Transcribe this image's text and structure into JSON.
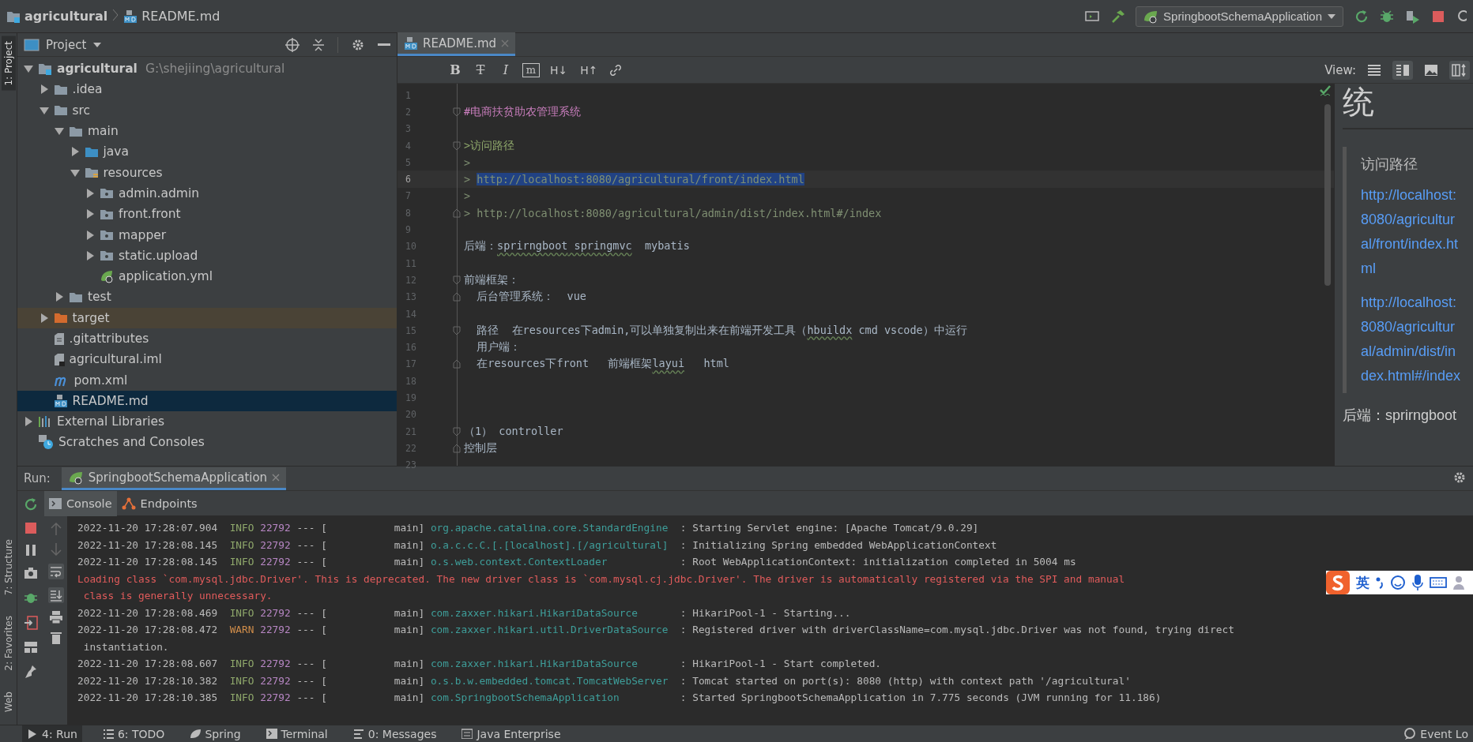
{
  "navbar": {
    "breadcrumbs": [
      {
        "label": "agricultural"
      },
      {
        "label": "README.md"
      }
    ],
    "run_config": "SpringbootSchemaApplication"
  },
  "side_strip": {
    "top": [
      {
        "label": "1: Project",
        "selected": true
      }
    ],
    "bottom": [
      {
        "label": "7: Structure",
        "selected": false
      },
      {
        "label": "2: Favorites",
        "selected": false
      },
      {
        "label": "Web",
        "selected": false
      }
    ]
  },
  "project": {
    "title": "Project",
    "tree": [
      {
        "label": "agricultural",
        "note": "G:\\shejiing\\agricultural",
        "kind": "module",
        "expanded": true,
        "selected": false,
        "children": [
          {
            "label": ".idea",
            "kind": "folder",
            "expanded": false,
            "selected": false
          },
          {
            "label": "src",
            "kind": "folder",
            "expanded": true,
            "selected": false,
            "children": [
              {
                "label": "main",
                "kind": "folder",
                "expanded": true,
                "selected": false,
                "children": [
                  {
                    "label": "java",
                    "kind": "source",
                    "expanded": false,
                    "selected": false
                  },
                  {
                    "label": "resources",
                    "kind": "resources",
                    "expanded": true,
                    "selected": false,
                    "children": [
                      {
                        "label": "admin.admin",
                        "kind": "package",
                        "expanded": false,
                        "selected": false
                      },
                      {
                        "label": "front.front",
                        "kind": "package",
                        "expanded": false,
                        "selected": false
                      },
                      {
                        "label": "mapper",
                        "kind": "package",
                        "expanded": false,
                        "selected": false
                      },
                      {
                        "label": "static.upload",
                        "kind": "package",
                        "expanded": false,
                        "selected": false
                      },
                      {
                        "label": "application.yml",
                        "kind": "spring",
                        "selected": false
                      }
                    ]
                  }
                ]
              },
              {
                "label": "test",
                "kind": "folder",
                "expanded": false,
                "selected": false
              }
            ]
          },
          {
            "label": "target",
            "kind": "excluded",
            "expanded": false,
            "selected": false
          },
          {
            "label": ".gitattributes",
            "kind": "text",
            "selected": false
          },
          {
            "label": "agricultural.iml",
            "kind": "iml",
            "selected": false
          },
          {
            "label": "pom.xml",
            "kind": "maven",
            "selected": false
          },
          {
            "label": "README.md",
            "kind": "markdown",
            "selected": true
          }
        ]
      },
      {
        "label": "External Libraries",
        "kind": "libraries",
        "expanded": false,
        "selected": false
      },
      {
        "label": "Scratches and Consoles",
        "kind": "scratches",
        "selected": false
      }
    ]
  },
  "editor": {
    "tabs": [
      {
        "label": "README.md",
        "selected": true
      }
    ],
    "toolbar": [
      {
        "kind": "bold",
        "label": "B"
      },
      {
        "kind": "strike",
        "label": "T"
      },
      {
        "kind": "italic",
        "label": "I"
      },
      {
        "kind": "code",
        "label": "m"
      },
      {
        "kind": "heading",
        "label": "H↓"
      },
      {
        "kind": "heading",
        "label": "H↑"
      },
      {
        "kind": "link"
      }
    ],
    "view_label": "View:",
    "lines": [
      {
        "number": "1",
        "kind": "line"
      },
      {
        "number": "2",
        "kind": "fold-start",
        "segments": [
          {
            "text": "#电商扶贫助农管理系统",
            "kind": "heading"
          }
        ]
      },
      {
        "number": "3",
        "kind": "line"
      },
      {
        "number": "4",
        "kind": "fold-start",
        "segments": [
          {
            "text": ">访问路径",
            "kind": "quote"
          }
        ]
      },
      {
        "number": "5",
        "kind": "line",
        "segments": [
          {
            "text": ">",
            "kind": "url"
          }
        ]
      },
      {
        "number": "6",
        "kind": "line",
        "current": true,
        "segments": [
          {
            "text": "> ",
            "kind": "url"
          },
          {
            "text": "http://localhost:8080/agricultural/front/index.html",
            "kind": "url",
            "selected": true
          }
        ]
      },
      {
        "number": "7",
        "kind": "line",
        "segments": [
          {
            "text": ">",
            "kind": "url"
          }
        ]
      },
      {
        "number": "8",
        "kind": "fold-end",
        "segments": [
          {
            "text": "> http://localhost:8080/agricultural/admin/dist/index.html#/index",
            "kind": "url"
          }
        ]
      },
      {
        "number": "9",
        "kind": "line"
      },
      {
        "number": "10",
        "kind": "line",
        "segments": [
          {
            "text": "后端：",
            "kind": "plain"
          },
          {
            "text": "sprirngboot",
            "kind": "typo"
          },
          {
            "text": " springmvc",
            "kind": "typo"
          },
          {
            "text": "  mybatis",
            "kind": "plain"
          }
        ]
      },
      {
        "number": "11",
        "kind": "line"
      },
      {
        "number": "12",
        "kind": "fold-start",
        "segments": [
          {
            "text": "前端框架：",
            "kind": "plain"
          }
        ]
      },
      {
        "number": "13",
        "kind": "fold-end",
        "segments": [
          {
            "text": "  后台管理系统：  vue",
            "kind": "plain"
          }
        ]
      },
      {
        "number": "14",
        "kind": "line"
      },
      {
        "number": "15",
        "kind": "fold-start",
        "segments": [
          {
            "text": "  路径  在resources下admin,可以单独复制出来在前端开发工具（",
            "kind": "plain"
          },
          {
            "text": "hbuildx",
            "kind": "typo"
          },
          {
            "text": " cmd vscode）中运行",
            "kind": "plain"
          }
        ]
      },
      {
        "number": "16",
        "kind": "line",
        "segments": [
          {
            "text": "  用户端：",
            "kind": "plain"
          }
        ]
      },
      {
        "number": "17",
        "kind": "fold-end",
        "segments": [
          {
            "text": "  在resources下front   前端框架",
            "kind": "plain"
          },
          {
            "text": "layui",
            "kind": "typo"
          },
          {
            "text": "   html",
            "kind": "plain"
          }
        ]
      },
      {
        "number": "18",
        "kind": "line"
      },
      {
        "number": "19",
        "kind": "line"
      },
      {
        "number": "20",
        "kind": "line"
      },
      {
        "number": "21",
        "kind": "fold-start",
        "segments": [
          {
            "text": "（1） controller",
            "kind": "plain"
          }
        ]
      },
      {
        "number": "22",
        "kind": "fold-end",
        "segments": [
          {
            "text": "控制层",
            "kind": "plain"
          }
        ]
      },
      {
        "number": "23",
        "kind": "line"
      }
    ]
  },
  "preview": {
    "heading": "统",
    "quote": "访问路径",
    "links": [
      "http://localhost:8080/agricultural/front/index.html",
      "http://localhost:8080/agricultural/admin/dist/index.html#/index"
    ],
    "paragraph": "后端：sprirngboot"
  },
  "run": {
    "label": "Run:",
    "tabs": [
      {
        "label": "SpringbootSchemaApplication",
        "selected": true
      }
    ],
    "subtabs": [
      {
        "label": "Console",
        "kind": "console",
        "selected": true
      },
      {
        "label": "Endpoints",
        "kind": "endpoints",
        "selected": false
      }
    ],
    "lines": [
      {
        "kind": "info",
        "time": "2022-11-20 17:28:07.904",
        "level": "INFO",
        "pid": "22792",
        "sep": "--- [",
        "thread": "main]",
        "logger": "org.apache.catalina.core.StandardEngine",
        "message": ": Starting Servlet engine: [Apache Tomcat/9.0.29]"
      },
      {
        "kind": "info",
        "time": "2022-11-20 17:28:08.145",
        "level": "INFO",
        "pid": "22792",
        "sep": "--- [",
        "thread": "main]",
        "logger": "o.a.c.c.C.[.[localhost].[/agricultural]",
        "message": ": Initializing Spring embedded WebApplicationContext"
      },
      {
        "kind": "info",
        "time": "2022-11-20 17:28:08.145",
        "level": "INFO",
        "pid": "22792",
        "sep": "--- [",
        "thread": "main]",
        "logger": "o.s.web.context.ContextLoader",
        "message": ": Root WebApplicationContext: initialization completed in 5004 ms"
      },
      {
        "kind": "error",
        "text": "Loading class `com.mysql.jdbc.Driver'. This is deprecated. The new driver class is `com.mysql.cj.jdbc.Driver'. The driver is automatically registered via the SPI and manual"
      },
      {
        "kind": "error",
        "text": " class is generally unnecessary."
      },
      {
        "kind": "info",
        "time": "2022-11-20 17:28:08.469",
        "level": "INFO",
        "pid": "22792",
        "sep": "--- [",
        "thread": "main]",
        "logger": "com.zaxxer.hikari.HikariDataSource",
        "message": ": HikariPool-1 - Starting..."
      },
      {
        "kind": "warn",
        "time": "2022-11-20 17:28:08.472",
        "level": "WARN",
        "pid": "22792",
        "sep": "--- [",
        "thread": "main]",
        "logger": "com.zaxxer.hikari.util.DriverDataSource",
        "message": ": Registered driver with driverClassName=com.mysql.jdbc.Driver was not found, trying direct"
      },
      {
        "kind": "plain",
        "text": " instantiation."
      },
      {
        "kind": "info",
        "time": "2022-11-20 17:28:08.607",
        "level": "INFO",
        "pid": "22792",
        "sep": "--- [",
        "thread": "main]",
        "logger": "com.zaxxer.hikari.HikariDataSource",
        "message": ": HikariPool-1 - Start completed."
      },
      {
        "kind": "info",
        "time": "2022-11-20 17:28:10.382",
        "level": "INFO",
        "pid": "22792",
        "sep": "--- [",
        "thread": "main]",
        "logger": "o.s.b.w.embedded.tomcat.TomcatWebServer",
        "message": ": Tomcat started on port(s): 8080 (http) with context path '/agricultural'"
      },
      {
        "kind": "info",
        "time": "2022-11-20 17:28:10.385",
        "level": "INFO",
        "pid": "22792",
        "sep": "--- [",
        "thread": "main]",
        "logger": "com.SpringbootSchemaApplication",
        "message": ": Started SpringbootSchemaApplication in 7.775 seconds (JVM running for 11.186)"
      }
    ]
  },
  "ime_bar": {
    "mode": "英"
  },
  "status_bar": {
    "tabs": [
      {
        "label": "4: Run",
        "kind": "run",
        "selected": true
      },
      {
        "label": "6: TODO",
        "kind": "list",
        "selected": false
      },
      {
        "label": "Spring",
        "kind": "leaf",
        "selected": false
      },
      {
        "label": "Terminal",
        "kind": "terminal",
        "selected": false
      },
      {
        "label": "0: Messages",
        "kind": "messages",
        "selected": false
      },
      {
        "label": "Java Enterprise",
        "kind": "enterprise",
        "selected": false
      }
    ],
    "right": "Event Lo"
  }
}
